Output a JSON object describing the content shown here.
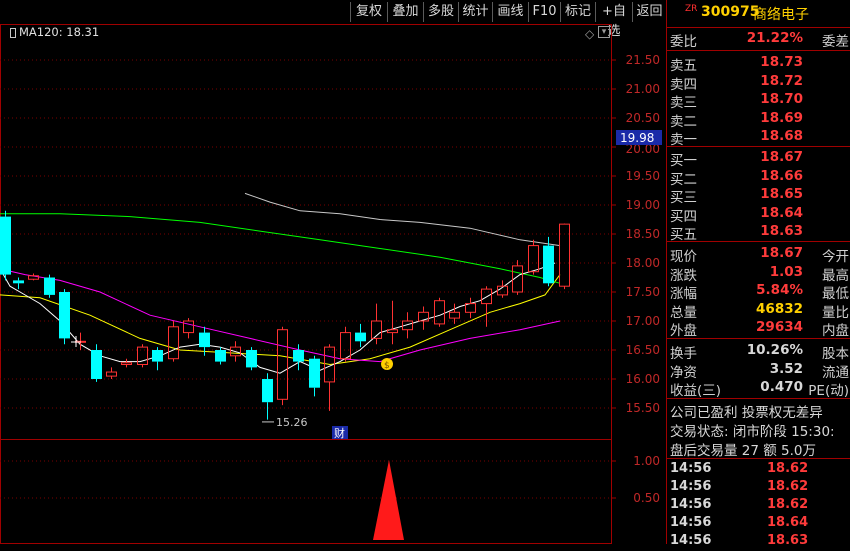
{
  "toolbar": {
    "buttons": [
      "复权",
      "叠加",
      "多股",
      "统计",
      "画线",
      "F10",
      "标记",
      "+自选",
      "返回"
    ]
  },
  "chart": {
    "ma_label": "MA120: 18.31",
    "price_axis": [
      "21.50",
      "21.00",
      "20.50",
      "19.50",
      "19.00",
      "18.50",
      "18.00",
      "17.50",
      "17.00",
      "16.50",
      "16.00",
      "15.50"
    ],
    "current_price_tag": "19.98",
    "hidden_tick": "20.00",
    "low_marker": "15.26",
    "finance_badge": "财",
    "volume_axis": [
      "1.00",
      "0.50"
    ],
    "colors": {
      "up": "#ff3232",
      "down": "#00ffff",
      "ma5": "#ffffff",
      "ma10": "#ffff00",
      "ma20": "#ff00ff",
      "ma60": "#00ff00"
    }
  },
  "quote": {
    "zr": "ZR",
    "code": "300975",
    "name": "商络电子",
    "weibi": {
      "label": "委比",
      "value": "21.22%",
      "right": "委差"
    },
    "asks": [
      {
        "label": "卖五",
        "price": "18.73"
      },
      {
        "label": "卖四",
        "price": "18.72"
      },
      {
        "label": "卖三",
        "price": "18.70"
      },
      {
        "label": "卖二",
        "price": "18.69"
      },
      {
        "label": "卖一",
        "price": "18.68"
      }
    ],
    "bids": [
      {
        "label": "买一",
        "price": "18.67"
      },
      {
        "label": "买二",
        "price": "18.66"
      },
      {
        "label": "买三",
        "price": "18.65"
      },
      {
        "label": "买四",
        "price": "18.64"
      },
      {
        "label": "买五",
        "price": "18.63"
      }
    ],
    "stats": [
      {
        "label": "现价",
        "value": "18.67",
        "right": "今开",
        "color": "#ff3b3b"
      },
      {
        "label": "涨跌",
        "value": "1.03",
        "right": "最高",
        "color": "#ff3b3b"
      },
      {
        "label": "涨幅",
        "value": "5.84%",
        "right": "最低",
        "color": "#ff3b3b"
      },
      {
        "label": "总量",
        "value": "46832",
        "right": "量比",
        "color": "#ffd000"
      },
      {
        "label": "外盘",
        "value": "29634",
        "right": "内盘",
        "color": "#ff3b3b"
      }
    ],
    "fundamentals": [
      {
        "label": "换手",
        "value": "10.26%",
        "right": "股本"
      },
      {
        "label": "净资",
        "value": "3.52",
        "right": "流通"
      },
      {
        "label": "收益(三)",
        "value": "0.470",
        "right": "PE(动)"
      }
    ],
    "info_lines": [
      "公司已盈利 投票权无差异",
      "交易状态: 闭市阶段 15:30:",
      "盘后交易量 27 额 5.0万"
    ],
    "ticks": [
      {
        "time": "14:56",
        "price": "18.62"
      },
      {
        "time": "14:56",
        "price": "18.62"
      },
      {
        "time": "14:56",
        "price": "18.62"
      },
      {
        "time": "14:56",
        "price": "18.64"
      },
      {
        "time": "14:56",
        "price": "18.63"
      }
    ]
  }
}
